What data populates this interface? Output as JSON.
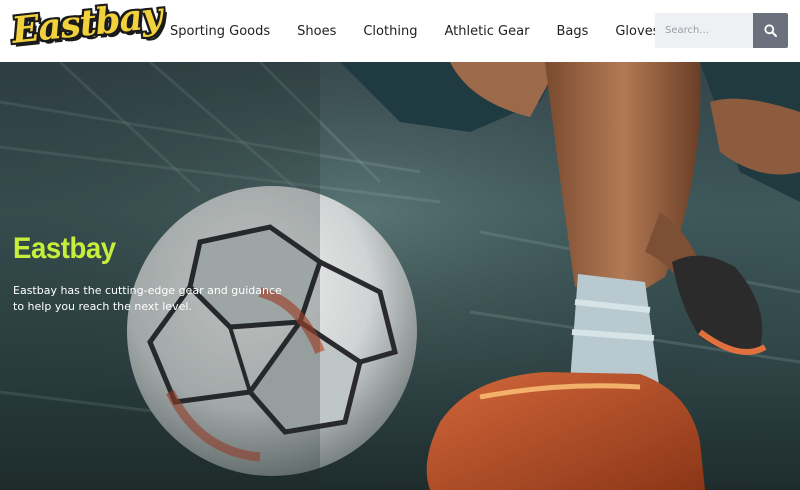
{
  "header": {
    "logo_text": "Eastbay",
    "nav": [
      {
        "label": "Sporting Goods"
      },
      {
        "label": "Shoes"
      },
      {
        "label": "Clothing"
      },
      {
        "label": "Athletic Gear"
      },
      {
        "label": "Bags"
      },
      {
        "label": "Gloves"
      }
    ],
    "search": {
      "placeholder": "Search...",
      "icon": "search-icon"
    }
  },
  "hero": {
    "title": "Eastbay",
    "text": "Eastbay has the cutting-edge gear and guidance to help you reach the next level.",
    "image": "soccer-ball-kick-photo"
  },
  "colors": {
    "logo_yellow": "#f2d23c",
    "hero_title_green": "#c7ee3c",
    "search_button": "#6b717c"
  }
}
